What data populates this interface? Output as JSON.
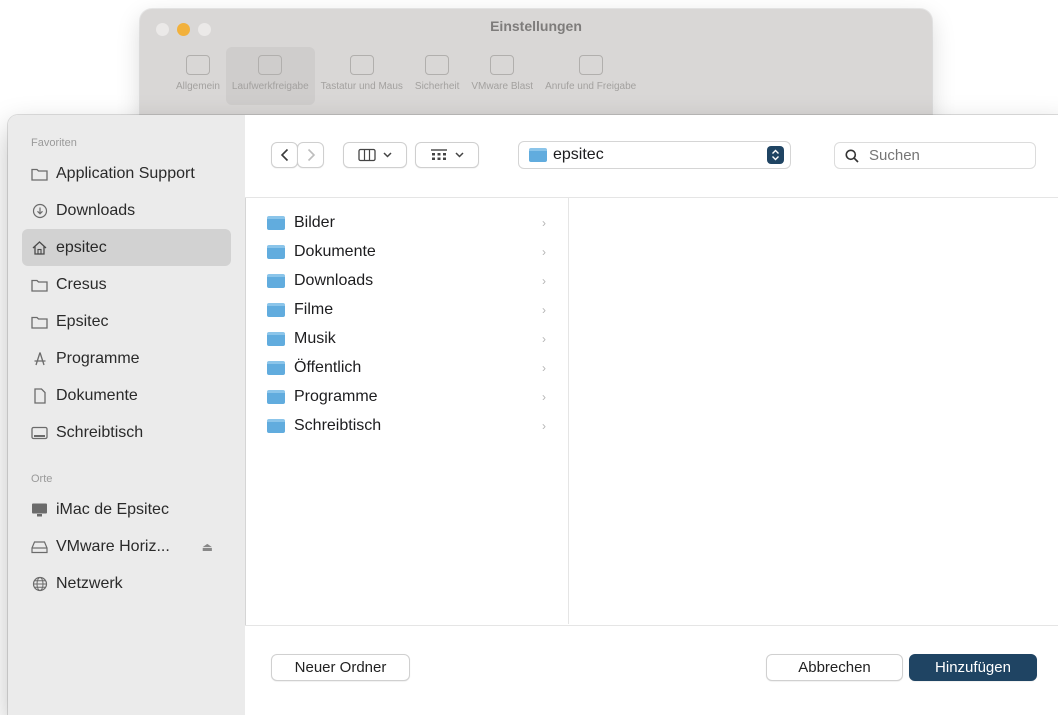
{
  "background_window": {
    "title": "Einstellungen",
    "toolbar": [
      "Allgemein",
      "Laufwerkfreigabe",
      "Tastatur und Maus",
      "Sicherheit",
      "VMware Blast",
      "Anrufe und Freigabe"
    ]
  },
  "sidebar": {
    "favorites_title": "Favoriten",
    "favorites": [
      {
        "label": "Application Support",
        "icon": "folder-icon"
      },
      {
        "label": "Downloads",
        "icon": "download-icon"
      },
      {
        "label": "epsitec",
        "icon": "home-icon",
        "selected": true
      },
      {
        "label": "Cresus",
        "icon": "folder-icon"
      },
      {
        "label": "Epsitec",
        "icon": "folder-icon"
      },
      {
        "label": "Programme",
        "icon": "apps-icon"
      },
      {
        "label": "Dokumente",
        "icon": "document-icon"
      },
      {
        "label": "Schreibtisch",
        "icon": "desktop-icon"
      }
    ],
    "places_title": "Orte",
    "places": [
      {
        "label": "iMac de Epsitec",
        "icon": "computer-icon"
      },
      {
        "label": "VMware Horiz...",
        "icon": "drive-icon",
        "eject": "⏏"
      },
      {
        "label": "Netzwerk",
        "icon": "network-icon"
      }
    ]
  },
  "toolbar": {
    "location": "epsitec",
    "search_placeholder": "Suchen"
  },
  "files": [
    {
      "name": "Bilder",
      "chevron": "›"
    },
    {
      "name": "Dokumente",
      "chevron": "›"
    },
    {
      "name": "Downloads",
      "chevron": "›"
    },
    {
      "name": "Filme",
      "chevron": "›"
    },
    {
      "name": "Musik",
      "chevron": "›"
    },
    {
      "name": "Öffentlich",
      "chevron": "›"
    },
    {
      "name": "Programme",
      "chevron": "›"
    },
    {
      "name": "Schreibtisch",
      "chevron": "›"
    }
  ],
  "buttons": {
    "new_folder": "Neuer Ordner",
    "cancel": "Abbrechen",
    "add": "Hinzufügen"
  },
  "colors": {
    "accent": "#1f4463",
    "folder": "#61acde",
    "sidebar_bg": "#ebebeb"
  }
}
